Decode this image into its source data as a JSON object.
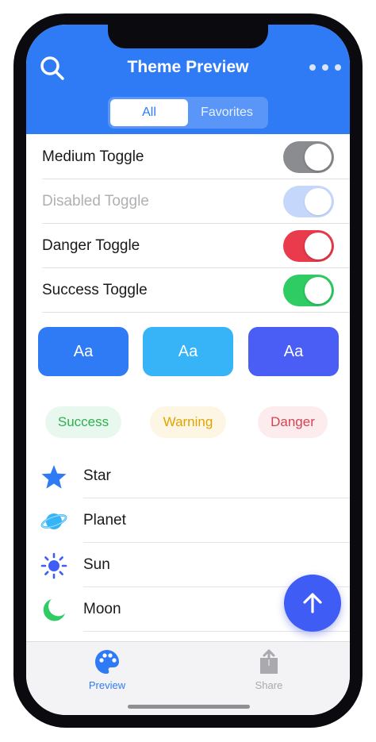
{
  "header": {
    "title": "Theme Preview",
    "segments": [
      {
        "label": "All",
        "active": true
      },
      {
        "label": "Favorites",
        "active": false
      }
    ]
  },
  "toggles": [
    {
      "label": "Medium Toggle",
      "state": "on",
      "color": "#8a8c90",
      "disabled": false
    },
    {
      "label": "Disabled Toggle",
      "state": "on",
      "color": "#c5d8fb",
      "disabled": true
    },
    {
      "label": "Danger Toggle",
      "state": "on",
      "color": "#e93b4b",
      "disabled": false
    },
    {
      "label": "Success Toggle",
      "state": "on",
      "color": "#2ecc63",
      "disabled": false
    }
  ],
  "style_buttons": [
    {
      "label": "Aa",
      "color": "#2f7bf6"
    },
    {
      "label": "Aa",
      "color": "#36b4f7"
    },
    {
      "label": "Aa",
      "color": "#4a5df5"
    }
  ],
  "badges": [
    {
      "label": "Success",
      "text_color": "#2bb24c",
      "bg_color": "#e9f8ee"
    },
    {
      "label": "Warning",
      "text_color": "#e0a400",
      "bg_color": "#fdf6e4"
    },
    {
      "label": "Danger",
      "text_color": "#d64350",
      "bg_color": "#fcecee"
    }
  ],
  "icon_list": [
    {
      "label": "Star",
      "icon": "star-icon",
      "color": "#2f7bf6"
    },
    {
      "label": "Planet",
      "icon": "planet-icon",
      "color": "#36b4f7"
    },
    {
      "label": "Sun",
      "icon": "sun-icon",
      "color": "#3f5cf5"
    },
    {
      "label": "Moon",
      "icon": "moon-icon",
      "color": "#2ecc63"
    }
  ],
  "fab": {
    "icon": "arrow-up-icon",
    "color": "#3f5cf5"
  },
  "tabbar": {
    "tabs": [
      {
        "label": "Preview",
        "icon": "palette-icon",
        "active": true,
        "color": "#2f7bf6"
      },
      {
        "label": "Share",
        "icon": "share-icon",
        "active": false,
        "color": "#a9a9ae"
      }
    ]
  },
  "colors": {
    "accent": "#2f7bf6",
    "header_bg": "#2f7bf6",
    "tabbar_bg": "#f3f3f5"
  }
}
